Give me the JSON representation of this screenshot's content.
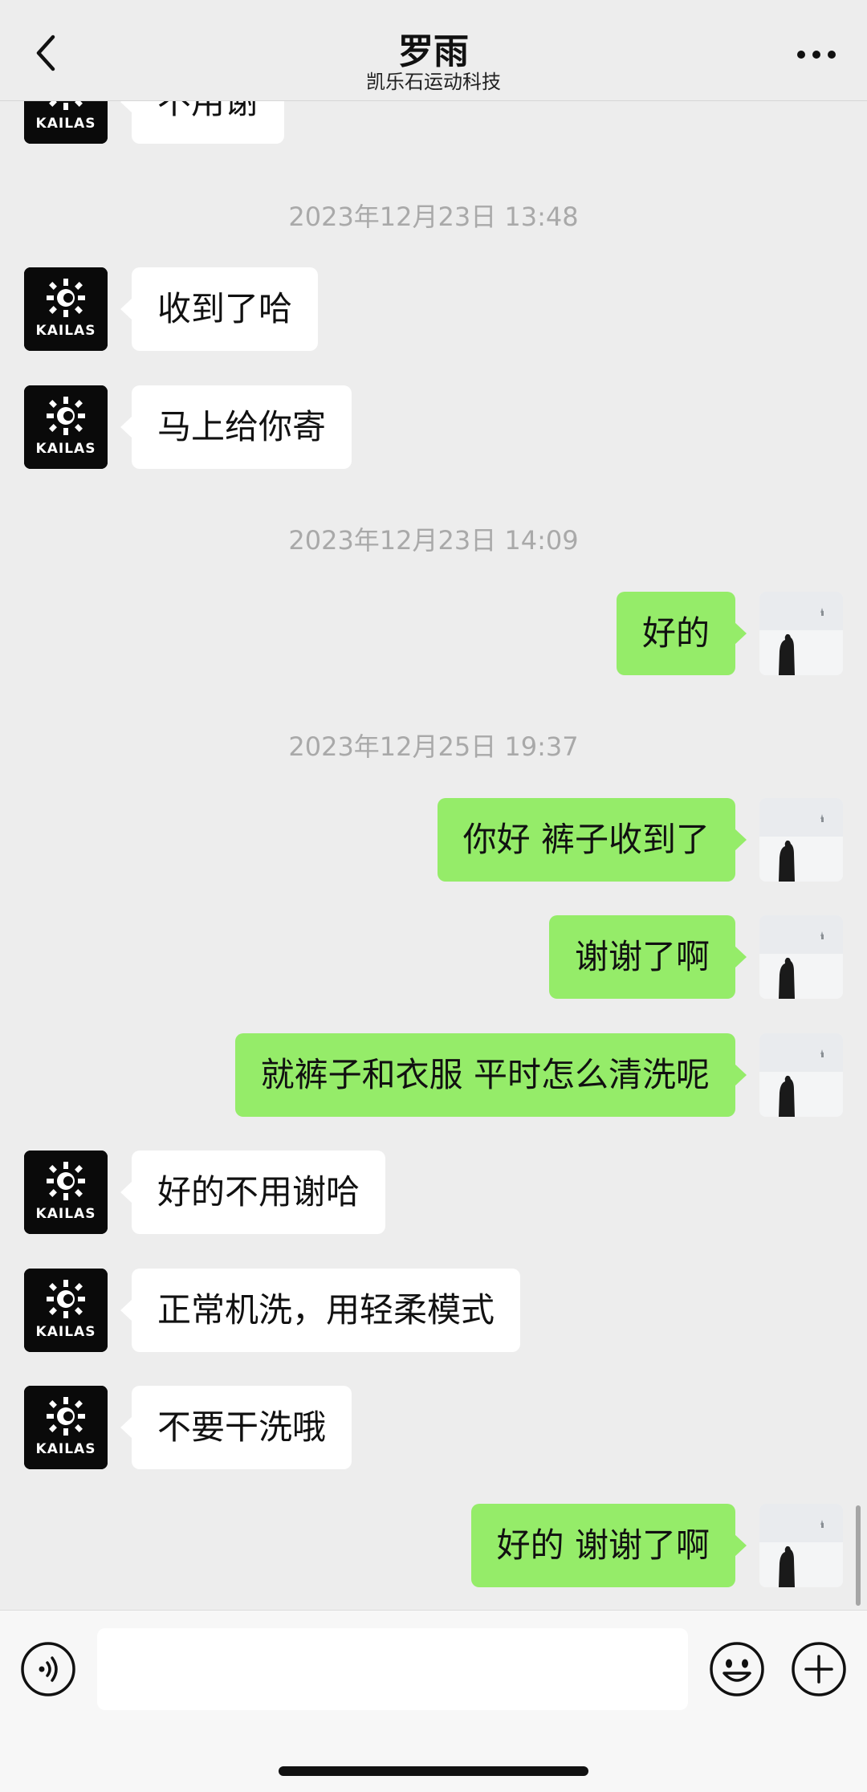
{
  "header": {
    "title": "罗雨",
    "subtitle": "凯乐石运动科技"
  },
  "chat": {
    "partial_top_message": "不用谢",
    "messages": [
      {
        "type": "time",
        "text": "2023年12月23日 13:48"
      },
      {
        "type": "in",
        "text": "收到了哈"
      },
      {
        "type": "in",
        "text": "马上给你寄"
      },
      {
        "type": "time",
        "text": "2023年12月23日 14:09"
      },
      {
        "type": "out",
        "text": "好的"
      },
      {
        "type": "time",
        "text": "2023年12月25日 19:37"
      },
      {
        "type": "out",
        "text": "你好 裤子收到了"
      },
      {
        "type": "out",
        "text": "谢谢了啊"
      },
      {
        "type": "out",
        "text": "就裤子和衣服 平时怎么清洗呢"
      },
      {
        "type": "in",
        "text": "好的不用谢哈"
      },
      {
        "type": "in",
        "text": "正常机洗，用轻柔模式"
      },
      {
        "type": "in",
        "text": "不要干洗哦"
      },
      {
        "type": "out",
        "text": "好的 谢谢了啊"
      }
    ]
  },
  "brand_logo_text": "KAILAS",
  "colors": {
    "background": "#ededed",
    "outgoing_bubble": "#95ec69",
    "incoming_bubble": "#ffffff",
    "timestamp": "#a9a9a9"
  },
  "icons": {
    "back": "chevron-left-icon",
    "more": "more-dots-icon",
    "voice": "voice-icon",
    "emoji": "emoji-icon",
    "plus": "plus-icon"
  },
  "input": {
    "value": "",
    "placeholder": ""
  }
}
